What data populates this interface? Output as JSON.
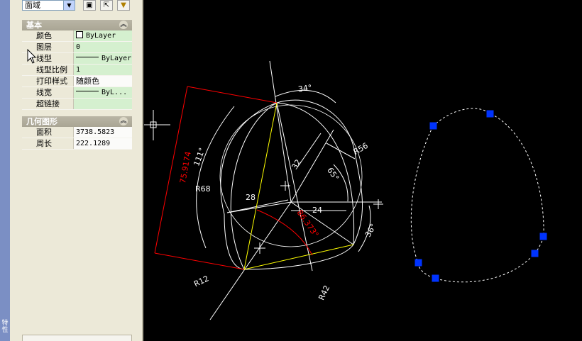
{
  "toolbar": {
    "selection_value": "面域",
    "buttons": [
      "quick-select-icon",
      "select-objects-icon",
      "filter-icon"
    ]
  },
  "sections": {
    "general": {
      "title": "基本",
      "rows": [
        {
          "label": "颜色",
          "value": "ByLayer"
        },
        {
          "label": "图层",
          "value": "0"
        },
        {
          "label": "线型",
          "value": "ByLayer"
        },
        {
          "label": "线型比例",
          "value": "1"
        },
        {
          "label": "打印样式",
          "value": "随颜色"
        },
        {
          "label": "线宽",
          "value": "ByL..."
        },
        {
          "label": "超链接",
          "value": ""
        }
      ]
    },
    "geometry": {
      "title": "几何图形",
      "rows": [
        {
          "label": "面积",
          "value": "3738.5823"
        },
        {
          "label": "周长",
          "value": "222.1289"
        }
      ]
    }
  },
  "left_strip_text": "特性",
  "drawing": {
    "dimensions": {
      "angle_top": "34°",
      "radius_r56": "R56",
      "length_32": "32",
      "angle_65": "65°",
      "angle_111": "111°",
      "radius_r68": "R68",
      "length_28": "28",
      "length_24": "24",
      "angle_36": "36°",
      "radius_r12": "R12",
      "radius_r42": "R42",
      "aligned_75": "75.9174",
      "aligned_86": "86.373°"
    },
    "colors": {
      "line": "#ffffff",
      "highlight": "#ff0000",
      "chord": "#ffff00",
      "grip": "#0033ff"
    }
  }
}
